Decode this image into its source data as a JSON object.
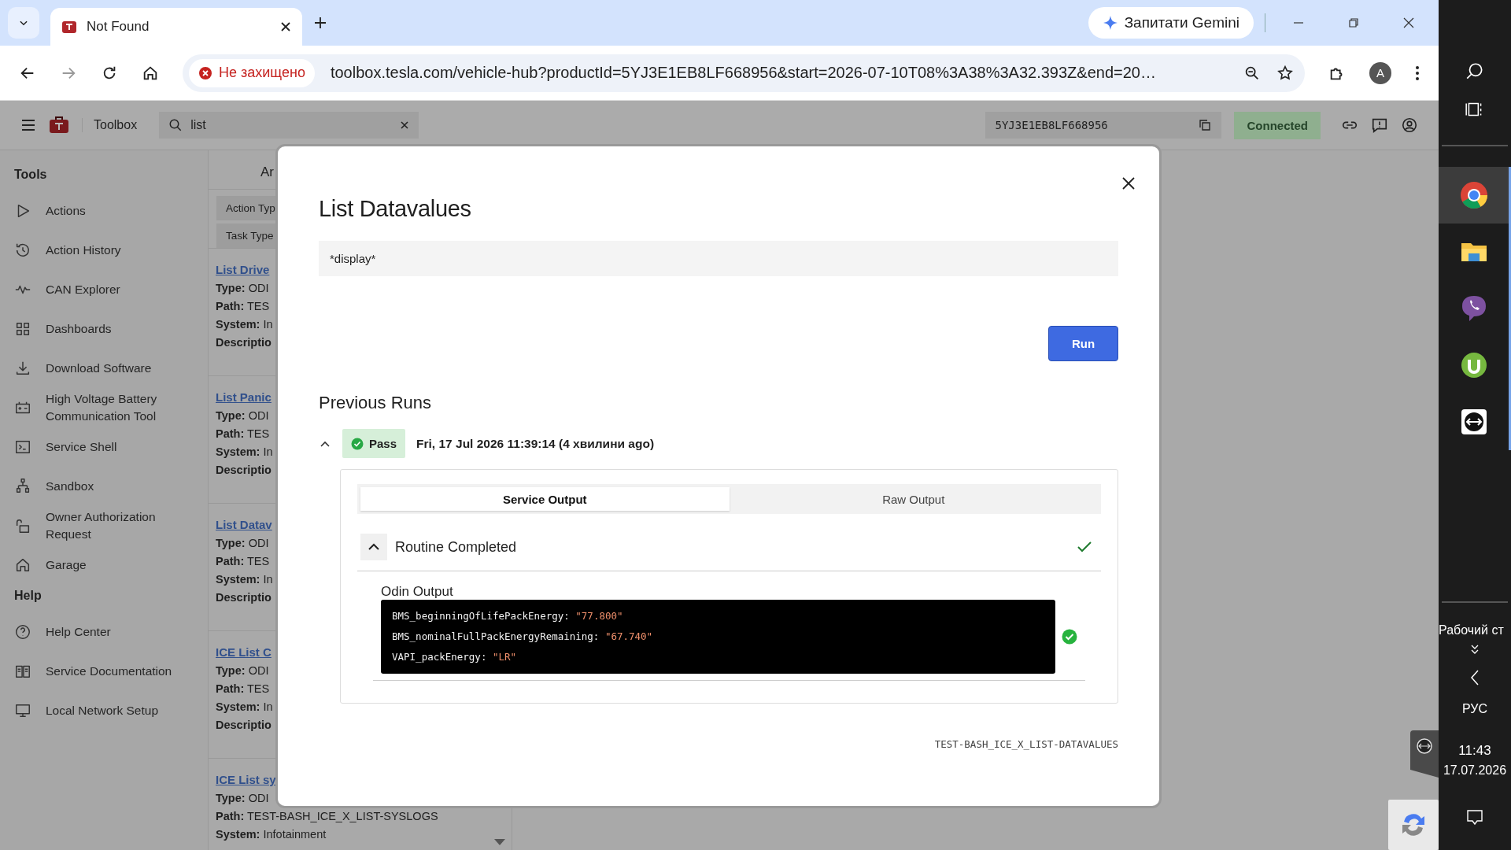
{
  "browser": {
    "tab": {
      "title": "Not Found"
    },
    "gemini_button": "Запитати Gemini",
    "security": "Не захищено",
    "url": "toolbox.tesla.com/vehicle-hub?productId=5YJ3E1EB8LF668956&start=2026-07-10T08%3A38%3A32.393Z&end=20…",
    "avatar": "A"
  },
  "app_bar": {
    "title": "Toolbox",
    "search": {
      "value": "list"
    },
    "vin": "5YJ3E1EB8LF668956",
    "status": "Connected"
  },
  "sidebar": {
    "sections": [
      {
        "heading": "Tools",
        "items": [
          "Actions",
          "Action History",
          "CAN Explorer",
          "Dashboards",
          "Download Software",
          "High Voltage Battery Communication Tool",
          "Service Shell",
          "Sandbox",
          "Owner Authorization Request",
          "Garage"
        ]
      },
      {
        "heading": "Help",
        "items": [
          "Help Center",
          "Service Documentation",
          "Local Network Setup"
        ]
      }
    ]
  },
  "actions_list": {
    "column_header": "Ar",
    "filters": [
      "Action Typ",
      "Task Type"
    ],
    "cards": [
      {
        "title": "List Drive",
        "lines": [
          "**Type:** ODI",
          "**Path:** TES",
          "**System:** In",
          "**Descriptio**"
        ]
      },
      {
        "title": "List Panic",
        "lines": [
          "**Type:** ODI",
          "**Path:** TES",
          "**System:** In",
          "**Descriptio**"
        ]
      },
      {
        "title": "List Datav",
        "lines": [
          "**Type:** ODI",
          "**Path:** TES",
          "**System:** In",
          "**Descriptio**"
        ]
      },
      {
        "title": "ICE List C",
        "lines": [
          "**Type:** ODI",
          "**Path:** TES",
          "**System:** In",
          "**Descriptio**"
        ]
      },
      {
        "title": "ICE List sy",
        "lines": [
          "**Type:** ODI",
          "**Path:** TEST-BASH_ICE_X_LIST-SYSLOGS",
          "**System:** Infotainment"
        ]
      }
    ]
  },
  "modal": {
    "title": "List Datavalues",
    "input": {
      "value": "*display*"
    },
    "run_button": "Run",
    "previous_runs_heading": "Previous Runs",
    "runs": [
      {
        "expanded": true,
        "status": "Pass",
        "time": "Fri, 17 Jul 2026 11:39:14 (4 хвилини ago)",
        "tabs": [
          {
            "label": "Service Output",
            "selected": true
          },
          {
            "label": "Raw Output",
            "selected": false
          }
        ],
        "sections": [
          {
            "title": "Routine Completed",
            "expanded": true,
            "outputs": [
              {
                "label": "Odin Output",
                "lines": [
                  {
                    "key": "BMS_beginningOfLifePackEnergy:",
                    "value": "\"77.800\""
                  },
                  {
                    "key": "BMS_nominalFullPackEnergyRemaining:",
                    "value": "\"67.740\""
                  },
                  {
                    "key": "VAPI_packEnergy:",
                    "value": "\"LR\""
                  }
                ]
              }
            ]
          }
        ]
      }
    ],
    "footer": "TEST-BASH_ICE_X_LIST-DATAVALUES"
  },
  "taskbar": {
    "apps": [
      {
        "selected": true
      },
      {
        "selected": false
      },
      {
        "selected": false
      },
      {
        "selected": false
      },
      {
        "selected": false
      }
    ],
    "desktop_label": "Рабочий ст",
    "language": "РУС",
    "time": "11:43",
    "date": "17.07.2026"
  }
}
